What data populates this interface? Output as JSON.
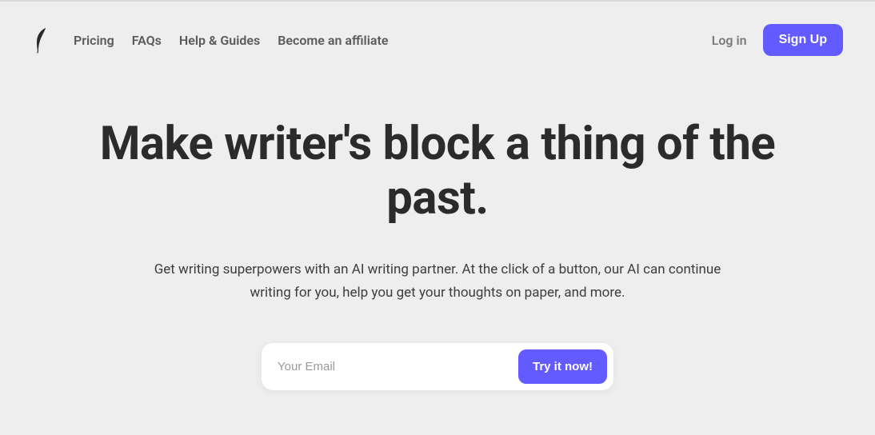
{
  "nav": {
    "items": [
      {
        "label": "Pricing"
      },
      {
        "label": "FAQs"
      },
      {
        "label": "Help & Guides"
      },
      {
        "label": "Become an affiliate"
      }
    ]
  },
  "header": {
    "login_label": "Log in",
    "signup_label": "Sign Up"
  },
  "hero": {
    "title": "Make writer's block a thing of the past.",
    "subtitle": "Get writing superpowers with an AI writing partner. At the click of a button, our AI can continue writing for you, help you get your thoughts on paper, and more."
  },
  "form": {
    "email_placeholder": "Your Email",
    "try_label": "Try it now!"
  },
  "colors": {
    "accent": "#635bff"
  }
}
